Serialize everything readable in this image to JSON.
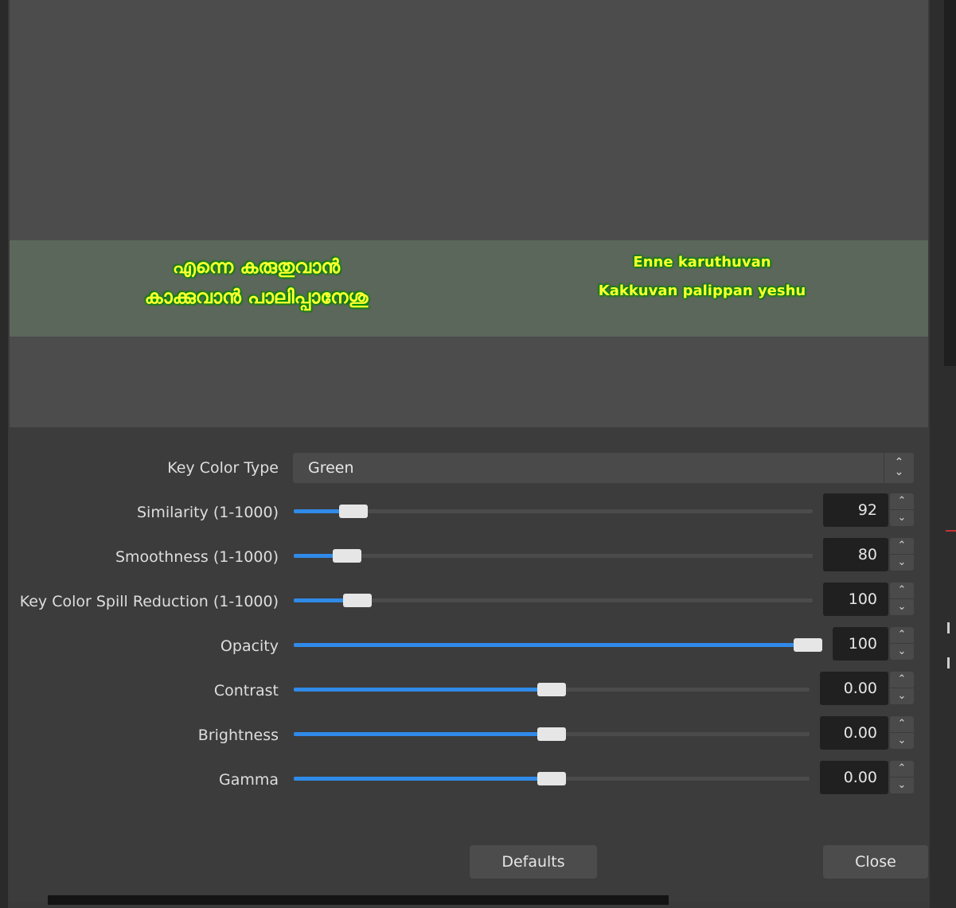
{
  "preview": {
    "lyric_malayalam": [
      "എന്നെ കരുതുവാൻ",
      "കാക്കുവാൻ പാലിപ്പാനേശു"
    ],
    "lyric_transliteration": [
      "Enne karuthuvan",
      "Kakkuvan palippan yeshu"
    ]
  },
  "key_color_type": {
    "label": "Key Color Type",
    "value": "Green"
  },
  "sliders": [
    {
      "name": "similarity",
      "label": "Similarity (1-1000)",
      "value": "92",
      "fraction": 0.092
    },
    {
      "name": "smoothness",
      "label": "Smoothness (1-1000)",
      "value": "80",
      "fraction": 0.08
    },
    {
      "name": "spill-reduction",
      "label": "Key Color Spill Reduction (1-1000)",
      "value": "100",
      "fraction": 0.1
    },
    {
      "name": "opacity",
      "label": "Opacity",
      "value": "100",
      "fraction": 1.0
    },
    {
      "name": "contrast",
      "label": "Contrast",
      "value": "0.00",
      "fraction": 0.5
    },
    {
      "name": "brightness",
      "label": "Brightness",
      "value": "0.00",
      "fraction": 0.5
    },
    {
      "name": "gamma",
      "label": "Gamma",
      "value": "0.00",
      "fraction": 0.5
    }
  ],
  "buttons": {
    "defaults": "Defaults",
    "close": "Close"
  },
  "icons": {
    "spin_up": "chevron-up-icon",
    "spin_down": "chevron-down-icon",
    "select": "up-down-arrows-icon"
  },
  "colors": {
    "accent": "#2f8ae8",
    "lyric_text": "#ffff33",
    "lyric_outline": "#00a400"
  }
}
